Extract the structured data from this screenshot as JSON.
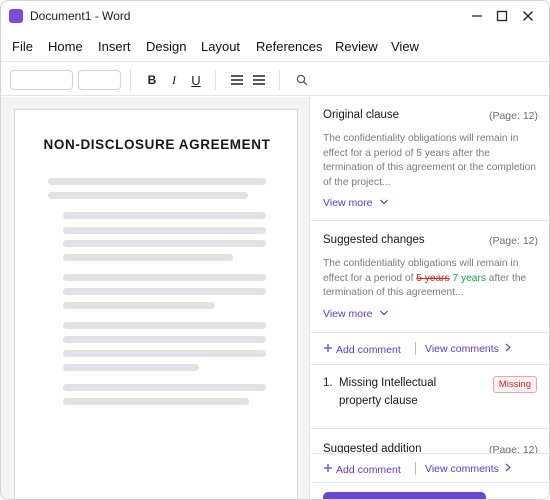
{
  "window": {
    "title": "Document1 - Word"
  },
  "menu": [
    "File",
    "Home",
    "Insert",
    "Design",
    "Layout",
    "References",
    "Review",
    "View"
  ],
  "toolbar": {
    "bold": "B",
    "italic": "I",
    "underline": "U"
  },
  "document": {
    "title": "NON-DISCLOSURE AGREEMENT"
  },
  "panel": {
    "original": {
      "heading": "Original clause",
      "page": "(Page: 12)",
      "text": "The confidentiality obligations will remain in effect for a period of 5 years after the termination of this agreement or the completion of the project...",
      "view_more": "View more"
    },
    "suggested": {
      "heading": "Suggested changes",
      "page": "(Page: 12)",
      "text_before": "The confidentiality obligations will remain in effect for a period of ",
      "deleted": "5 years",
      "inserted": "7 years",
      "text_after": " after the termination of this agreement...",
      "view_more": "View more"
    },
    "actions": {
      "add_comment": "Add comment",
      "view_comments": "View comments"
    },
    "missing": {
      "number": "1.",
      "text": "Missing Intellectual property clause",
      "badge": "Missing"
    },
    "addition": {
      "heading": "Suggested addition",
      "page": "(Page: 12)"
    }
  }
}
